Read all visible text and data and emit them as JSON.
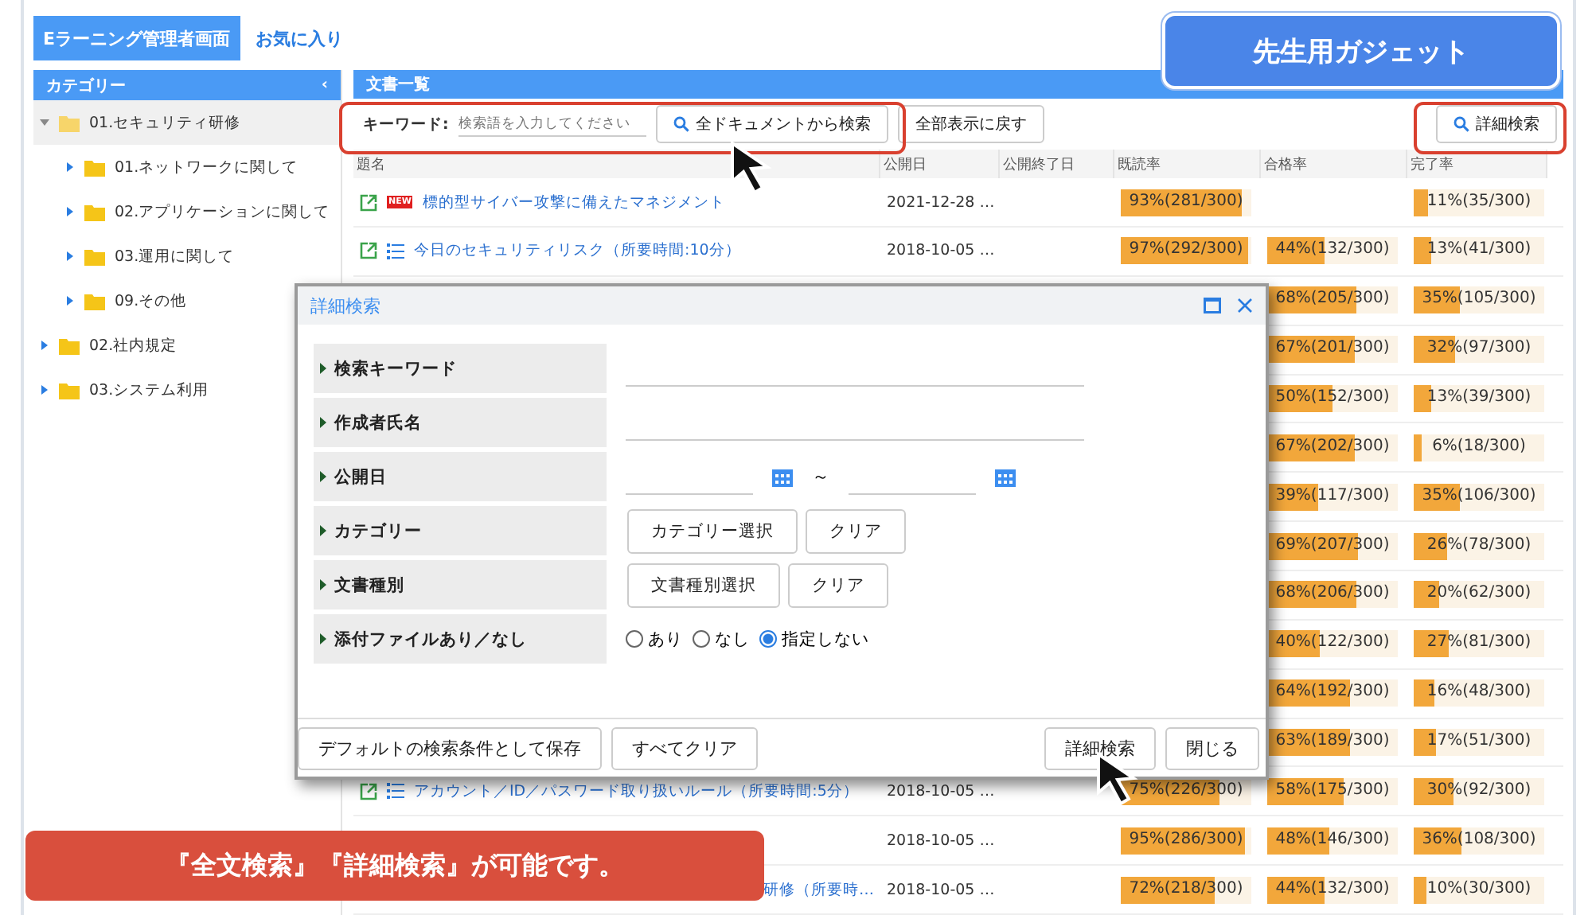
{
  "tabs": [
    {
      "label": "Eラーニング管理者画面",
      "selected": true
    },
    {
      "label": "お気に入り",
      "selected": false
    }
  ],
  "sidebar": {
    "title": "カテゴリー",
    "collapse_glyph": "‹",
    "items": [
      {
        "label": "01.セキュリティ研修",
        "expanded": true,
        "selected": true,
        "children": [
          {
            "label": "01.ネットワークに関して",
            "expanded": false,
            "selected": false
          },
          {
            "label": "02.アプリケーションに関して",
            "expanded": false,
            "selected": false
          },
          {
            "label": "03.運用に関して",
            "expanded": false,
            "selected": false
          },
          {
            "label": "09.その他",
            "expanded": false,
            "selected": false
          }
        ]
      },
      {
        "label": "02.社内規定",
        "expanded": false,
        "selected": false
      },
      {
        "label": "03.システム利用",
        "expanded": false,
        "selected": false
      }
    ]
  },
  "documents": {
    "title": "文書一覧",
    "keyword_label": "キーワード:",
    "keyword_placeholder": "検索語を入力してください",
    "search_button": "全ドキュメントから検索",
    "reset_button": "全部表示に戻す",
    "detail_button": "詳細検索",
    "columns": [
      "題名",
      "公開日",
      "公開終了日",
      "既読率",
      "合格率",
      "完了率"
    ],
    "rows": [
      {
        "kind": "new",
        "title": "標的型サイバー攻撃に備えたマネジメント",
        "badge": "NEW",
        "date": "2021-12-28 …",
        "read": {
          "text": "93%(281/300)",
          "level": 0.93
        },
        "complete": {
          "text": "11%(35/300)",
          "level": 0.11
        }
      },
      {
        "kind": "list",
        "title": "今日のセキュリティリスク（所要時間:10分）",
        "date": "2018-10-05 …",
        "read": {
          "text": "97%(292/300)",
          "level": 0.97
        },
        "pass": {
          "text": "44%(132/300)",
          "level": 0.44
        },
        "complete": {
          "text": "13%(41/300)",
          "level": 0.13
        }
      },
      {
        "pass": {
          "text": "68%(205/300)",
          "level": 0.68
        },
        "complete": {
          "text": "35%(105/300)",
          "level": 0.35
        }
      },
      {
        "pass": {
          "text": "67%(201/300)",
          "level": 0.67
        },
        "complete": {
          "text": "32%(97/300)",
          "level": 0.32
        }
      },
      {
        "pass": {
          "text": "50%(152/300)",
          "level": 0.5
        },
        "complete": {
          "text": "13%(39/300)",
          "level": 0.13
        }
      },
      {
        "pass": {
          "text": "67%(202/300)",
          "level": 0.67
        },
        "complete": {
          "text": "6%(18/300)",
          "level": 0.06
        }
      },
      {
        "pass": {
          "text": "39%(117/300)",
          "level": 0.39
        },
        "complete": {
          "text": "35%(106/300)",
          "level": 0.35
        }
      },
      {
        "pass": {
          "text": "69%(207/300)",
          "level": 0.69
        },
        "complete": {
          "text": "26%(78/300)",
          "level": 0.26
        }
      },
      {
        "pass": {
          "text": "68%(206/300)",
          "level": 0.68
        },
        "complete": {
          "text": "20%(62/300)",
          "level": 0.2
        }
      },
      {
        "pass": {
          "text": "40%(122/300)",
          "level": 0.4
        },
        "complete": {
          "text": "27%(81/300)",
          "level": 0.27
        }
      },
      {
        "pass": {
          "text": "64%(192/300)",
          "level": 0.64
        },
        "complete": {
          "text": "16%(48/300)",
          "level": 0.16
        }
      },
      {
        "pass": {
          "text": "63%(189/300)",
          "level": 0.63
        },
        "complete": {
          "text": "17%(51/300)",
          "level": 0.17
        }
      },
      {
        "kind": "list",
        "title": "アカウント／ID／パスワード取り扱いルール（所要時間:5分）",
        "date": "2018-10-05 …",
        "read": {
          "text": "75%(226/300)",
          "level": 0.75
        },
        "pass": {
          "text": "58%(175/300)",
          "level": 0.58
        },
        "complete": {
          "text": "30%(92/300)",
          "level": 0.3
        }
      },
      {
        "date": "2018-10-05 …",
        "read": {
          "text": "95%(286/300)",
          "level": 0.95
        },
        "pass": {
          "text": "48%(146/300)",
          "level": 0.48
        },
        "complete": {
          "text": "36%(108/300)",
          "level": 0.36
        }
      },
      {
        "kind": "tail",
        "title": "研修（所要時…",
        "date": "2018-10-05 …",
        "read": {
          "text": "72%(218/300)",
          "level": 0.72
        },
        "pass": {
          "text": "44%(132/300)",
          "level": 0.44
        },
        "complete": {
          "text": "10%(30/300)",
          "level": 0.1
        }
      }
    ]
  },
  "dialog": {
    "title": "詳細検索",
    "fields": [
      {
        "kind": "text",
        "label": "検索キーワード"
      },
      {
        "kind": "text",
        "label": "作成者氏名"
      },
      {
        "kind": "daterange",
        "label": "公開日",
        "separator": "～"
      },
      {
        "kind": "select",
        "label": "カテゴリー",
        "buttons": [
          "カテゴリー選択",
          "クリア"
        ]
      },
      {
        "kind": "select",
        "label": "文書種別",
        "buttons": [
          "文書種別選択",
          "クリア"
        ]
      },
      {
        "kind": "radio",
        "label": "添付ファイルあり／なし",
        "options": [
          {
            "label": "あり",
            "selected": false
          },
          {
            "label": "なし",
            "selected": false
          },
          {
            "label": "指定しない",
            "selected": true
          }
        ]
      }
    ],
    "footer_left": [
      "デフォルトの検索条件として保存",
      "すべてクリア"
    ],
    "footer_right": [
      "詳細検索",
      "閉じる"
    ]
  },
  "callouts": {
    "badge": "先生用ガジェット",
    "banner": "『全文検索』『詳細検索』が可能です。"
  }
}
